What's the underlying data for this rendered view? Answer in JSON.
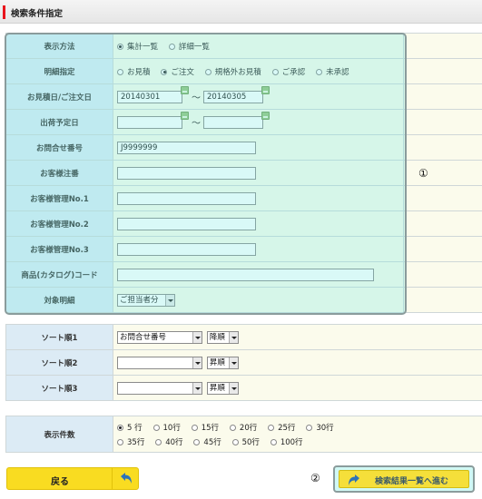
{
  "header": {
    "title": "検索条件指定"
  },
  "filters": {
    "display_method": {
      "label": "表示方法",
      "options": [
        "集計一覧",
        "詳細一覧"
      ],
      "selected": "集計一覧"
    },
    "detail_type": {
      "label": "明細指定",
      "options": [
        "お見積",
        "ご注文",
        "規格外お見積",
        "ご承認",
        "未承認"
      ],
      "selected": "ご注文"
    },
    "order_date": {
      "label": "お見積日/ご注文日",
      "from": "20140301",
      "to": "20140305",
      "separator": "～"
    },
    "ship_date": {
      "label": "出荷予定日",
      "from": "",
      "to": "",
      "separator": "～"
    },
    "inquiry_no": {
      "label": "お問合せ番号",
      "value": "J9999999"
    },
    "customer_order_no": {
      "label": "お客様注番",
      "value": ""
    },
    "customer_mgmt1": {
      "label": "お客様管理No.1",
      "value": ""
    },
    "customer_mgmt2": {
      "label": "お客様管理No.2",
      "value": ""
    },
    "customer_mgmt3": {
      "label": "お客様管理No.3",
      "value": ""
    },
    "product_code": {
      "label": "商品(カタログ)コード",
      "value": ""
    },
    "target_detail": {
      "label": "対象明細",
      "selected": "ご担当者分"
    }
  },
  "annotations": {
    "marker1": "①",
    "marker2": "②"
  },
  "sort": {
    "rows": [
      {
        "label": "ソート順1",
        "field": "お問合せ番号",
        "order": "降順"
      },
      {
        "label": "ソート順2",
        "field": "",
        "order": "昇順"
      },
      {
        "label": "ソート順3",
        "field": "",
        "order": "昇順"
      }
    ]
  },
  "count": {
    "label": "表示件数",
    "options": [
      "5 行",
      "10行",
      "15行",
      "20行",
      "25行",
      "30行",
      "35行",
      "40行",
      "45行",
      "50行",
      "100行"
    ],
    "selected": "5 行"
  },
  "buttons": {
    "back": "戻る",
    "search": "検索結果一覧へ進む"
  },
  "colors": {
    "accent_red": "#e8141c",
    "label_bg": "#dcebf5",
    "value_bg": "#fbfbec",
    "button_yellow": "#f9dc21",
    "highlight_teal": "#78ebe1"
  }
}
